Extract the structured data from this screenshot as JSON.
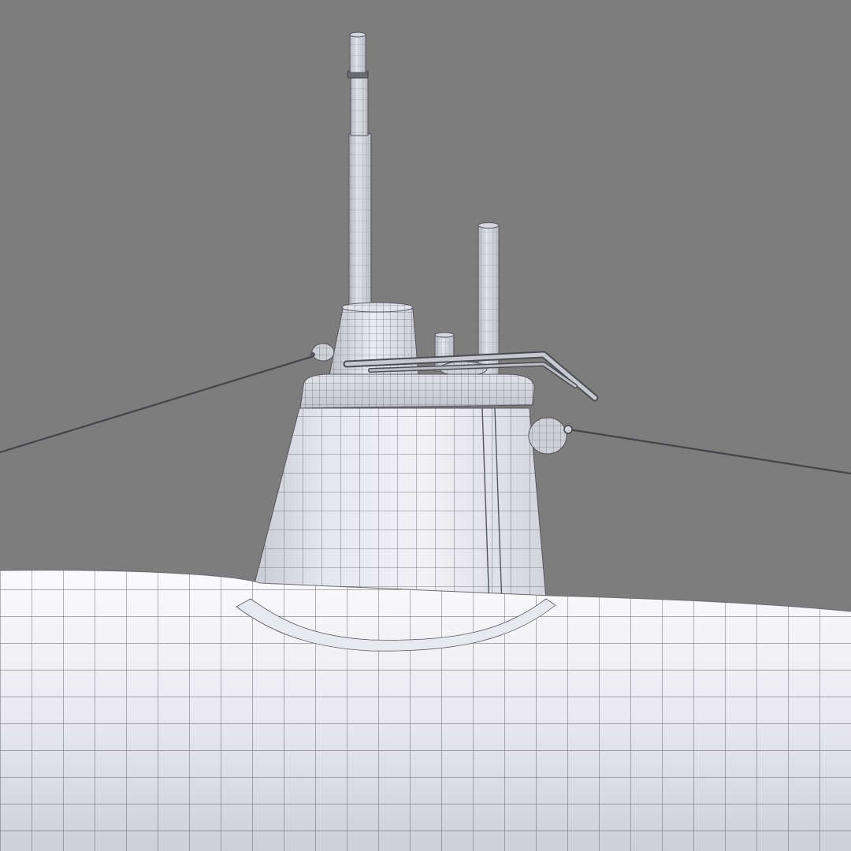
{
  "scene": {
    "subject": "submarine-sail-wireframe",
    "colors": {
      "background": "#7d7d7d",
      "surface_light": "#f4f4f8",
      "surface_mid": "#dcdce4",
      "surface_dark": "#b8b8c2",
      "wire": "#55555f",
      "cable": "#4a4a50"
    },
    "masts": [
      "tall-periscope-mast",
      "short-periscope-mast",
      "snorkel-stub"
    ],
    "fittings": [
      "handrail",
      "left-cable-fairlead",
      "right-cable-fairlead"
    ],
    "cables": [
      "left-guy-cable",
      "right-guy-cable"
    ]
  }
}
